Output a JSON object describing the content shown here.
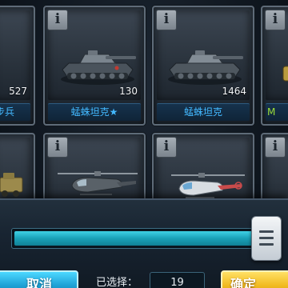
{
  "cards": [
    {
      "id": "left-top",
      "count": "527",
      "name": "步兵",
      "name_style": "blue"
    },
    {
      "id": "mid-top",
      "count": "130",
      "name": "蜢蛛坦克★",
      "name_style": "blue"
    },
    {
      "id": "right-top",
      "count": "1464",
      "name": "蜢蛛坦克",
      "name_style": "blue"
    },
    {
      "id": "edge-top",
      "count": "",
      "name": "M",
      "name_style": "green"
    }
  ],
  "info_label": "i",
  "selection": {
    "slider_fraction": 0.99,
    "cancel_label": "取消",
    "confirm_label": "确定",
    "selected_label": "已选择：",
    "selected_value": "19"
  },
  "colors": {
    "name_blue": "#43b9ff",
    "name_green": "#9bdc3a",
    "slider_fill": "#1aa1b8",
    "cancel_button": "#1fa2d6",
    "confirm_button": "#f2bc22"
  }
}
